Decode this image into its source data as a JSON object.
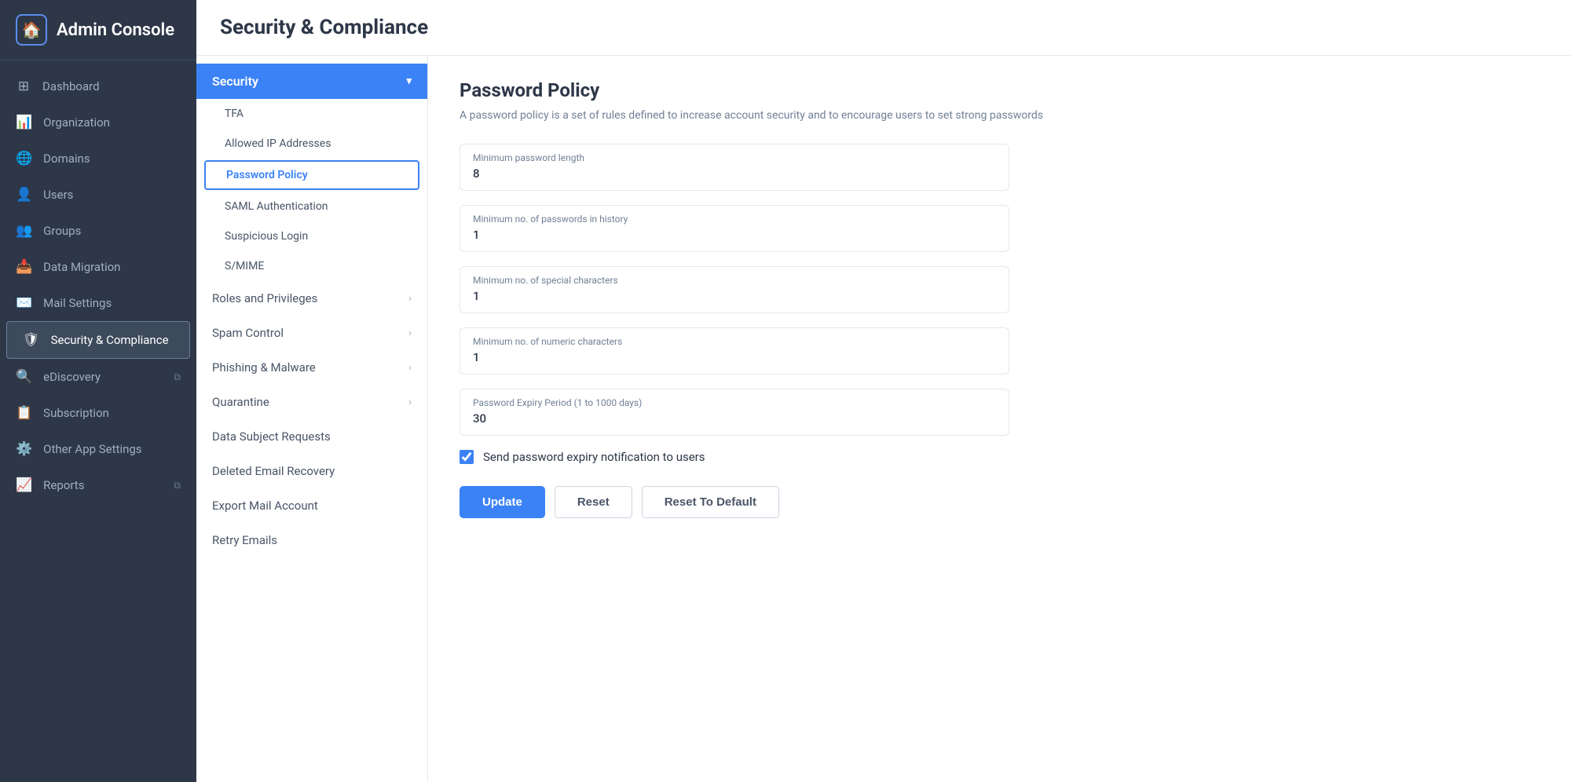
{
  "sidebar": {
    "title": "Admin Console",
    "logo_icon": "🏠",
    "items": [
      {
        "id": "dashboard",
        "label": "Dashboard",
        "icon": "⊞",
        "active": false,
        "external": false
      },
      {
        "id": "organization",
        "label": "Organization",
        "icon": "📊",
        "active": false,
        "external": false
      },
      {
        "id": "domains",
        "label": "Domains",
        "icon": "🌐",
        "active": false,
        "external": false
      },
      {
        "id": "users",
        "label": "Users",
        "icon": "👤",
        "active": false,
        "external": false
      },
      {
        "id": "groups",
        "label": "Groups",
        "icon": "👥",
        "active": false,
        "external": false
      },
      {
        "id": "data-migration",
        "label": "Data Migration",
        "icon": "📥",
        "active": false,
        "external": false
      },
      {
        "id": "mail-settings",
        "label": "Mail Settings",
        "icon": "✉️",
        "active": false,
        "external": false
      },
      {
        "id": "security-compliance",
        "label": "Security & Compliance",
        "icon": "🛡",
        "active": true,
        "external": false
      },
      {
        "id": "ediscovery",
        "label": "eDiscovery",
        "icon": "🔍",
        "active": false,
        "external": true
      },
      {
        "id": "subscription",
        "label": "Subscription",
        "icon": "📋",
        "active": false,
        "external": false
      },
      {
        "id": "other-app-settings",
        "label": "Other App Settings",
        "icon": "⚙️",
        "active": false,
        "external": false
      },
      {
        "id": "reports",
        "label": "Reports",
        "icon": "📈",
        "active": false,
        "external": true
      }
    ]
  },
  "header": {
    "title": "Security & Compliance"
  },
  "sub_nav": {
    "sections": [
      {
        "id": "security",
        "label": "Security",
        "expanded": true,
        "has_arrow": true,
        "children": [
          {
            "id": "tfa",
            "label": "TFA",
            "active": false
          },
          {
            "id": "allowed-ip",
            "label": "Allowed IP Addresses",
            "active": false
          },
          {
            "id": "password-policy",
            "label": "Password Policy",
            "active": true
          },
          {
            "id": "saml",
            "label": "SAML Authentication",
            "active": false
          },
          {
            "id": "suspicious-login",
            "label": "Suspicious Login",
            "active": false
          },
          {
            "id": "smime",
            "label": "S/MIME",
            "active": false
          }
        ]
      },
      {
        "id": "roles-privileges",
        "label": "Roles and Privileges",
        "has_arrow": true
      },
      {
        "id": "spam-control",
        "label": "Spam Control",
        "has_arrow": true
      },
      {
        "id": "phishing-malware",
        "label": "Phishing & Malware",
        "has_arrow": true
      },
      {
        "id": "quarantine",
        "label": "Quarantine",
        "has_arrow": true
      },
      {
        "id": "data-subject-requests",
        "label": "Data Subject Requests",
        "has_arrow": false
      },
      {
        "id": "deleted-email-recovery",
        "label": "Deleted Email Recovery",
        "has_arrow": false
      },
      {
        "id": "export-mail-account",
        "label": "Export Mail Account",
        "has_arrow": false
      },
      {
        "id": "retry-emails",
        "label": "Retry Emails",
        "has_arrow": false
      }
    ]
  },
  "detail": {
    "title": "Password Policy",
    "description": "A password policy is a set of rules defined to increase account security and to encourage users to set strong passwords",
    "fields": [
      {
        "id": "min-password-length",
        "label": "Minimum password length",
        "value": "8"
      },
      {
        "id": "min-passwords-history",
        "label": "Minimum no. of passwords in history",
        "value": "1"
      },
      {
        "id": "min-special-chars",
        "label": "Minimum no. of special characters",
        "value": "1"
      },
      {
        "id": "min-numeric-chars",
        "label": "Minimum no. of numeric characters",
        "value": "1"
      },
      {
        "id": "password-expiry",
        "label": "Password Expiry Period (1 to 1000 days)",
        "value": "30"
      }
    ],
    "checkbox": {
      "id": "send-expiry-notification",
      "label": "Send password expiry notification to users",
      "checked": true
    },
    "buttons": [
      {
        "id": "update",
        "label": "Update",
        "type": "primary"
      },
      {
        "id": "reset",
        "label": "Reset",
        "type": "secondary"
      },
      {
        "id": "reset-to-default",
        "label": "Reset To Default",
        "type": "secondary"
      }
    ]
  }
}
